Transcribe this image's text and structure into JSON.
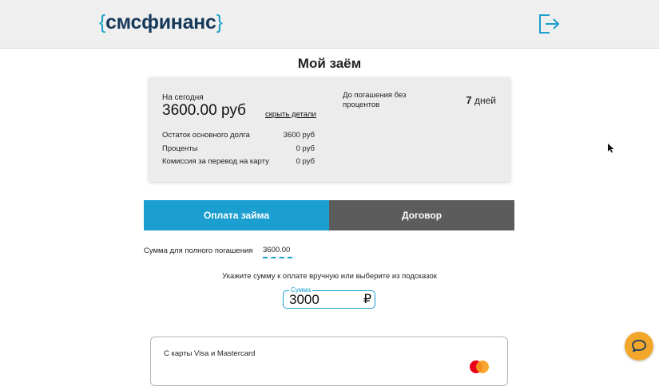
{
  "header": {
    "logo_open": "{",
    "logo_text": "смсфинанс",
    "logo_close": "}",
    "logout_icon": "logout-icon"
  },
  "page": {
    "title": "Мой заём"
  },
  "loan": {
    "today_label": "На сегодня",
    "today_amount": "3600.00 руб",
    "hide_details": "скрыть детали",
    "details": [
      {
        "label": "Остаток основного долга",
        "value": "3600 руб"
      },
      {
        "label": "Проценты",
        "value": "0 руб"
      },
      {
        "label": "Комиссия за перевод на карту",
        "value": "0 руб"
      }
    ],
    "grace_label": "До погашения без процентов",
    "grace_days_number": "7",
    "grace_days_unit": "дней"
  },
  "tabs": {
    "pay": "Оплата займа",
    "contract": "Договор"
  },
  "payment": {
    "full_label": "Сумма для полного погашения",
    "full_value": "3600.00",
    "hint": "Укажите сумму к оплате вручную или выберите из подсказок",
    "amount_legend": "Сумма",
    "amount_value": "3000",
    "currency_sign": "₽"
  },
  "card": {
    "label": "С карты Visa и Mastercard",
    "icon": "mastercard-icon"
  },
  "colors": {
    "accent": "#1a9fd0",
    "logo_dark": "#16395a",
    "tab_dark": "#5c5c5c",
    "chat": "#f2a72b"
  }
}
